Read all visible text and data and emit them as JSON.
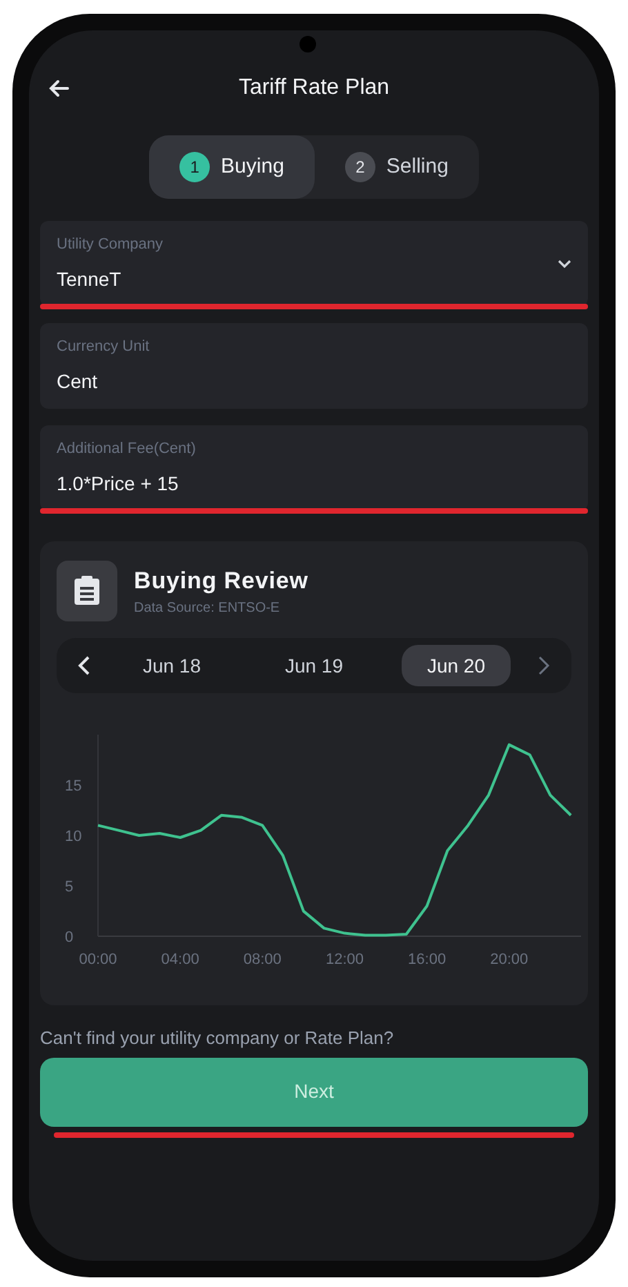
{
  "header": {
    "title": "Tariff Rate Plan"
  },
  "steps": [
    {
      "number": "1",
      "label": "Buying",
      "selected": true
    },
    {
      "number": "2",
      "label": "Selling",
      "selected": false
    }
  ],
  "fields": [
    {
      "kind": "select",
      "label": "Utility Company",
      "value": "TenneT",
      "highlighted": true
    },
    {
      "kind": "text",
      "label": "Currency Unit",
      "value": "Cent",
      "highlighted": false
    },
    {
      "kind": "text",
      "label": "Additional Fee(Cent)",
      "value": "1.0*Price  + 15",
      "highlighted": true
    }
  ],
  "review": {
    "title": "Buying Review",
    "subtitle": "Data Source: ENTSO-E",
    "dates": [
      {
        "label": "Jun 18",
        "selected": false
      },
      {
        "label": "Jun 19",
        "selected": false
      },
      {
        "label": "Jun 20",
        "selected": true
      }
    ],
    "chart_data": {
      "type": "line",
      "x": [
        0,
        1,
        2,
        3,
        4,
        5,
        6,
        7,
        8,
        9,
        10,
        11,
        12,
        13,
        14,
        15,
        16,
        17,
        18,
        19,
        20,
        21,
        22,
        23
      ],
      "series": [
        {
          "color": "#3fc28f",
          "values": [
            11,
            10.5,
            10,
            10.2,
            9.8,
            10.5,
            12,
            11.8,
            11,
            8,
            2.5,
            0.8,
            0.3,
            0.1,
            0.1,
            0.2,
            3,
            8.5,
            11,
            14,
            19,
            18,
            14,
            12
          ]
        }
      ],
      "xlim": [
        0,
        23.5
      ],
      "ylim": [
        0,
        20
      ],
      "xticks": [
        {
          "value": 0,
          "label": "00:00"
        },
        {
          "value": 4,
          "label": "04:00"
        },
        {
          "value": 8,
          "label": "08:00"
        },
        {
          "value": 12,
          "label": "12:00"
        },
        {
          "value": 16,
          "label": "16:00"
        },
        {
          "value": 20,
          "label": "20:00"
        }
      ],
      "yticks": [
        0,
        5,
        10,
        15
      ]
    }
  },
  "help_text": "Can't find your utility company or Rate Plan?",
  "next_button": {
    "label": "Next",
    "highlighted": true
  }
}
